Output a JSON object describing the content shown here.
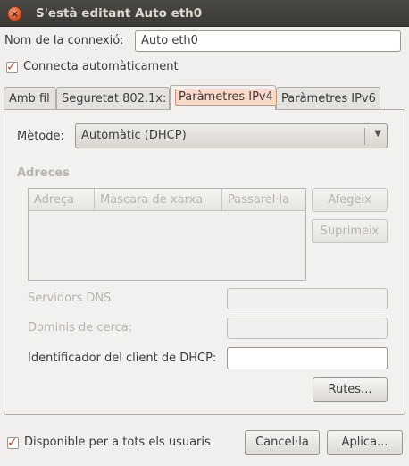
{
  "window": {
    "title": "S'està editant Auto eth0"
  },
  "connection_name": {
    "label": "Nom de la connexió:",
    "value": "Auto eth0"
  },
  "auto_connect": {
    "label": "Connecta automàticament",
    "checked": true
  },
  "tabs": [
    {
      "label": "Amb fil"
    },
    {
      "label": "Seguretat 802.1x:"
    },
    {
      "label": "Paràmetres IPv4",
      "active": true
    },
    {
      "label": "Paràmetres IPv6"
    }
  ],
  "method": {
    "label": "Mètode:",
    "value": "Automàtic (DHCP)"
  },
  "addresses": {
    "title": "Adreces",
    "columns": [
      "Adreça",
      "Màscara de xarxa",
      "Passarel·la"
    ],
    "add_button": "Afegeix",
    "remove_button": "Suprimeix"
  },
  "dns_servers": {
    "label": "Servidors DNS:",
    "value": ""
  },
  "search_domains": {
    "label": "Dominis de cerca:",
    "value": ""
  },
  "dhcp_client_id": {
    "label": "Identificador del client de DHCP:",
    "value": ""
  },
  "routes_button": "Rutes...",
  "available_all_users": {
    "label": "Disponible per a tots els usuaris",
    "checked": true
  },
  "cancel_button": "Cancel·la",
  "apply_button": "Aplica...",
  "colors": {
    "accent": "#d9411e",
    "title_bar": "#3c3b37",
    "active_tab_highlight": "#fbd9c8"
  }
}
